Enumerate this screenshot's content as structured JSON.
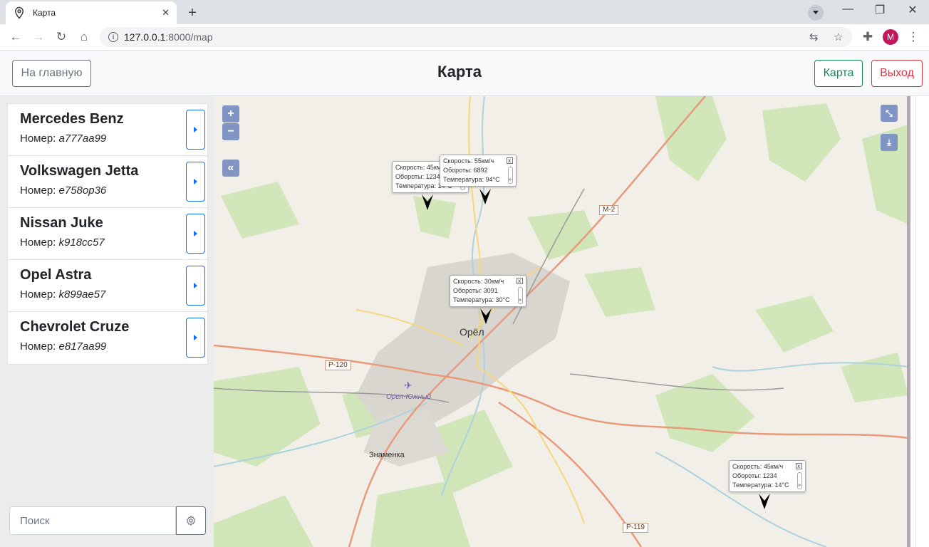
{
  "browser": {
    "tab_title": "Карта",
    "url_host": "127.0.0.1",
    "url_path": ":8000/map",
    "profile_initial": "M"
  },
  "header": {
    "home_button": "На главную",
    "title": "Карта",
    "map_button": "Карта",
    "exit_button": "Выход"
  },
  "sidebar": {
    "cars": [
      {
        "name": "Mercedes Benz",
        "plate_label": "Номер: ",
        "plate": "a777aa99"
      },
      {
        "name": "Volkswagen Jetta",
        "plate_label": "Номер: ",
        "plate": "e758op36"
      },
      {
        "name": "Nissan Juke",
        "plate_label": "Номер: ",
        "plate": "k918cc57"
      },
      {
        "name": "Opel Astra",
        "plate_label": "Номер: ",
        "plate": "k899ae57"
      },
      {
        "name": "Chevrolet Cruze",
        "plate_label": "Номер: ",
        "plate": "e817aa99"
      }
    ],
    "search_placeholder": "Поиск"
  },
  "map": {
    "controls": {
      "zoom_in": "+",
      "zoom_out": "−",
      "collapse": "«"
    },
    "labels": {
      "city": "Орёл",
      "airport": "Орел-Южный",
      "town": "Знаменка"
    },
    "roads": {
      "m2": "M-2",
      "p120": "P-120",
      "p119": "P-119"
    },
    "popups": [
      {
        "speed": "Скорость: 45км/ч",
        "rpm": "Обороты: 1234",
        "temp": "Температура: 14°C"
      },
      {
        "speed": "Скорость: 55км/ч",
        "rpm": "Обороты: 6892",
        "temp": "Температура: 94°C"
      },
      {
        "speed": "Скорость: 30км/ч",
        "rpm": "Обороты: 3091",
        "temp": "Температура: 30°C"
      },
      {
        "speed": "Скорость: 45км/ч",
        "rpm": "Обороты: 1234",
        "temp": "Температура: 14°C"
      }
    ]
  }
}
